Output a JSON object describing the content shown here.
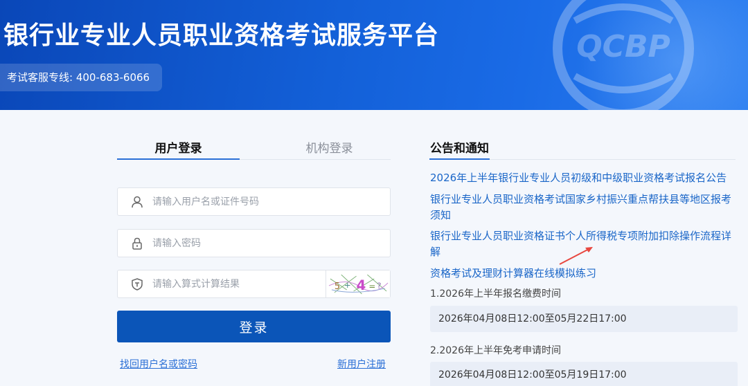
{
  "header": {
    "title": "银行业专业人员职业资格考试服务平台",
    "hotline": "考试客服专线: 400-683-6066",
    "watermark_text": "QCBP"
  },
  "login": {
    "tabs": [
      {
        "label": "用户登录",
        "active": true
      },
      {
        "label": "机构登录",
        "active": false
      }
    ],
    "username_placeholder": "请输入用户名或证件号码",
    "password_placeholder": "请输入密码",
    "captcha_placeholder": "请输入算式计算结果",
    "submit_label": "登录",
    "forgot_label": "找回用户名或密码",
    "register_label": "新用户注册"
  },
  "notices": {
    "heading": "公告和通知",
    "items": [
      "2026年上半年银行业专业人员初级和中级职业资格考试报名公告",
      "银行业专业人员职业资格考试国家乡村振兴重点帮扶县等地区报考须知",
      "银行业专业人员职业资格证书个人所得税专项附加扣除操作流程详解",
      "资格考试及理财计算器在线模拟练习"
    ],
    "schedule": [
      {
        "label": "1.2026年上半年报名缴费时间",
        "value": "2026年04月08日12:00至05月22日17:00"
      },
      {
        "label": "2.2026年上半年免考申请时间",
        "value": "2026年04月08日12:00至05月19日17:00"
      }
    ]
  },
  "colors": {
    "brand_blue": "#0b55b8",
    "link_blue": "#1a66c8",
    "annotation_red": "#e8473f"
  },
  "icons": [
    "user-icon",
    "lock-icon",
    "shield-icon",
    "qcbp-logo",
    "captcha-image",
    "annotation-arrow"
  ]
}
